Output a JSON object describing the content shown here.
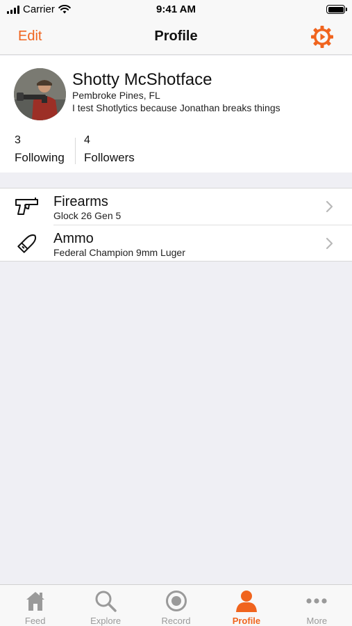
{
  "status_bar": {
    "carrier": "Carrier",
    "time": "9:41 AM"
  },
  "nav": {
    "edit_label": "Edit",
    "title": "Profile",
    "settings_icon": "gear-icon"
  },
  "profile": {
    "name": "Shotty McShotface",
    "location": "Pembroke Pines, FL",
    "bio": "I test Shotlytics because Jonathan breaks things",
    "following_count": "3",
    "following_label": "Following",
    "followers_count": "4",
    "followers_label": "Followers"
  },
  "gear": [
    {
      "title": "Firearms",
      "subtitle": "Glock 26 Gen 5",
      "icon": "pistol-icon"
    },
    {
      "title": "Ammo",
      "subtitle": "Federal Champion 9mm Luger",
      "icon": "bullet-icon"
    }
  ],
  "tabs": [
    {
      "label": "Feed",
      "icon": "home-icon",
      "active": false
    },
    {
      "label": "Explore",
      "icon": "search-icon",
      "active": false
    },
    {
      "label": "Record",
      "icon": "record-icon",
      "active": false
    },
    {
      "label": "Profile",
      "icon": "person-icon",
      "active": true
    },
    {
      "label": "More",
      "icon": "more-icon",
      "active": false
    }
  ],
  "colors": {
    "accent": "#f0641e",
    "inactive": "#9a9a9a",
    "background": "#efeff4"
  }
}
